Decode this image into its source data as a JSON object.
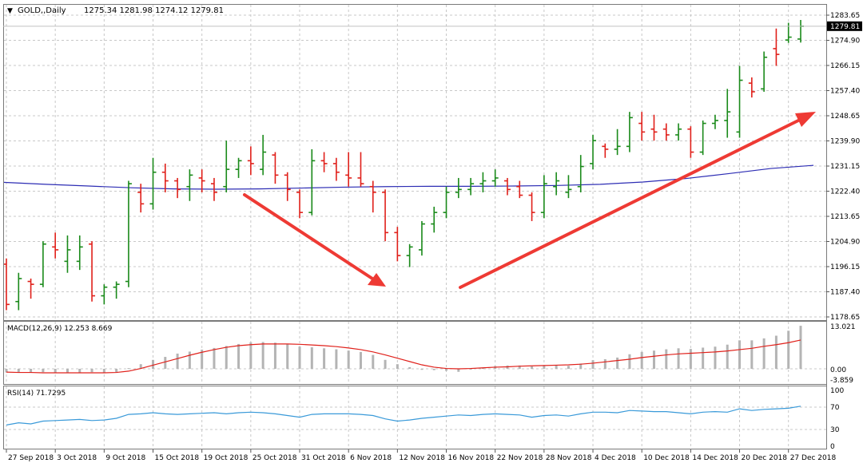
{
  "window": {
    "title_arrow": "▼",
    "symbol": "GOLD,,Daily",
    "ohlc": "1275.34 1281.98 1274.12 1279.81"
  },
  "price_panel": {
    "y_ticks": [
      "1283.65",
      "1274.90",
      "1266.15",
      "1257.40",
      "1248.65",
      "1239.90",
      "1231.15",
      "1222.40",
      "1213.65",
      "1204.90",
      "1196.15",
      "1187.40",
      "1178.65"
    ],
    "current_price_label": "1279.81",
    "current_price": 1279.81
  },
  "macd_panel": {
    "label": "MACD(12,26,9) 12.253 8.669",
    "y_ticks": [
      "13.021",
      "0.00",
      "-3.859"
    ]
  },
  "rsi_panel": {
    "label": "RSI(14) 71.7295",
    "y_ticks": [
      "100",
      "70",
      "30",
      "0"
    ]
  },
  "x_axis": {
    "labels": [
      "27 Sep 2018",
      "3 Oct 2018",
      "9 Oct 2018",
      "15 Oct 2018",
      "19 Oct 2018",
      "25 Oct 2018",
      "31 Oct 2018",
      "6 Nov 2018",
      "12 Nov 2018",
      "16 Nov 2018",
      "22 Nov 2018",
      "28 Nov 2018",
      "4 Dec 2018",
      "10 Dec 2018",
      "14 Dec 2018",
      "20 Dec 2018",
      "27 Dec 2018"
    ]
  },
  "colors": {
    "up_bar": "#1a8a1a",
    "down_bar": "#e0201a",
    "moving_average": "#2d2db4",
    "macd_signal": "#e0201a",
    "macd_histogram": "#b4b4b4",
    "rsi_line": "#3a9ad9",
    "annotation_arrow": "#ee3a34",
    "grid": "#c8c8c8"
  },
  "chart_data": [
    {
      "type": "ohlc",
      "series": [
        {
          "name": "GOLD,,Daily",
          "values": [
            {
              "d": "2018-09-27",
              "o": 1197,
              "h": 1199,
              "l": 1181,
              "c": 1183
            },
            {
              "d": "2018-09-28",
              "o": 1184,
              "h": 1194,
              "l": 1181,
              "c": 1192
            },
            {
              "d": "2018-10-01",
              "o": 1191,
              "h": 1192,
              "l": 1185,
              "c": 1190
            },
            {
              "d": "2018-10-02",
              "o": 1190,
              "h": 1205,
              "l": 1189,
              "c": 1204
            },
            {
              "d": "2018-10-03",
              "o": 1203,
              "h": 1208,
              "l": 1199,
              "c": 1202
            },
            {
              "d": "2018-10-04",
              "o": 1198,
              "h": 1207,
              "l": 1194,
              "c": 1202
            },
            {
              "d": "2018-10-05",
              "o": 1198,
              "h": 1207,
              "l": 1195,
              "c": 1203
            },
            {
              "d": "2018-10-08",
              "o": 1204,
              "h": 1205,
              "l": 1184,
              "c": 1186
            },
            {
              "d": "2018-10-09",
              "o": 1186,
              "h": 1190,
              "l": 1183,
              "c": 1189
            },
            {
              "d": "2018-10-10",
              "o": 1189,
              "h": 1191,
              "l": 1185,
              "c": 1190
            },
            {
              "d": "2018-10-11",
              "o": 1191,
              "h": 1226,
              "l": 1189,
              "c": 1225
            },
            {
              "d": "2018-10-12",
              "o": 1222,
              "h": 1225,
              "l": 1215,
              "c": 1218
            },
            {
              "d": "2018-10-15",
              "o": 1218,
              "h": 1234,
              "l": 1216,
              "c": 1229
            },
            {
              "d": "2018-10-16",
              "o": 1229,
              "h": 1232,
              "l": 1222,
              "c": 1226
            },
            {
              "d": "2018-10-17",
              "o": 1226,
              "h": 1227,
              "l": 1220,
              "c": 1223
            },
            {
              "d": "2018-10-18",
              "o": 1224,
              "h": 1230,
              "l": 1219,
              "c": 1228
            },
            {
              "d": "2018-10-19",
              "o": 1227,
              "h": 1230,
              "l": 1222,
              "c": 1226
            },
            {
              "d": "2018-10-22",
              "o": 1225,
              "h": 1227,
              "l": 1219,
              "c": 1222
            },
            {
              "d": "2018-10-23",
              "o": 1224,
              "h": 1240,
              "l": 1222,
              "c": 1230
            },
            {
              "d": "2018-10-24",
              "o": 1230,
              "h": 1234,
              "l": 1227,
              "c": 1233
            },
            {
              "d": "2018-10-25",
              "o": 1233,
              "h": 1238,
              "l": 1228,
              "c": 1232
            },
            {
              "d": "2018-10-26",
              "o": 1230,
              "h": 1242,
              "l": 1228,
              "c": 1236
            },
            {
              "d": "2018-10-29",
              "o": 1235,
              "h": 1236,
              "l": 1225,
              "c": 1228
            },
            {
              "d": "2018-10-30",
              "o": 1228,
              "h": 1229,
              "l": 1219,
              "c": 1223
            },
            {
              "d": "2018-10-31",
              "o": 1222,
              "h": 1223,
              "l": 1213,
              "c": 1215
            },
            {
              "d": "2018-11-01",
              "o": 1215,
              "h": 1237,
              "l": 1214,
              "c": 1233
            },
            {
              "d": "2018-11-02",
              "o": 1233,
              "h": 1236,
              "l": 1229,
              "c": 1232
            },
            {
              "d": "2018-11-05",
              "o": 1232,
              "h": 1234,
              "l": 1226,
              "c": 1229
            },
            {
              "d": "2018-11-06",
              "o": 1228,
              "h": 1236,
              "l": 1224,
              "c": 1227
            },
            {
              "d": "2018-11-07",
              "o": 1227,
              "h": 1236,
              "l": 1224,
              "c": 1225
            },
            {
              "d": "2018-11-08",
              "o": 1224,
              "h": 1226,
              "l": 1215,
              "c": 1222
            },
            {
              "d": "2018-11-09",
              "o": 1222,
              "h": 1223,
              "l": 1205,
              "c": 1208
            },
            {
              "d": "2018-11-12",
              "o": 1208,
              "h": 1210,
              "l": 1198,
              "c": 1200
            },
            {
              "d": "2018-11-13",
              "o": 1200,
              "h": 1204,
              "l": 1196,
              "c": 1203
            },
            {
              "d": "2018-11-14",
              "o": 1202,
              "h": 1212,
              "l": 1200,
              "c": 1211
            },
            {
              "d": "2018-11-15",
              "o": 1211,
              "h": 1217,
              "l": 1208,
              "c": 1215
            },
            {
              "d": "2018-11-16",
              "o": 1215,
              "h": 1224,
              "l": 1213,
              "c": 1222
            },
            {
              "d": "2018-11-19",
              "o": 1222,
              "h": 1227,
              "l": 1220,
              "c": 1223
            },
            {
              "d": "2018-11-20",
              "o": 1223,
              "h": 1227,
              "l": 1221,
              "c": 1225
            },
            {
              "d": "2018-11-21",
              "o": 1225,
              "h": 1229,
              "l": 1222,
              "c": 1226
            },
            {
              "d": "2018-11-22",
              "o": 1226,
              "h": 1230,
              "l": 1224,
              "c": 1227
            },
            {
              "d": "2018-11-23",
              "o": 1226,
              "h": 1227,
              "l": 1221,
              "c": 1223
            },
            {
              "d": "2018-11-26",
              "o": 1224,
              "h": 1226,
              "l": 1220,
              "c": 1221
            },
            {
              "d": "2018-11-27",
              "o": 1221,
              "h": 1222,
              "l": 1212,
              "c": 1215
            },
            {
              "d": "2018-11-28",
              "o": 1215,
              "h": 1228,
              "l": 1213,
              "c": 1225
            },
            {
              "d": "2018-11-29",
              "o": 1224,
              "h": 1229,
              "l": 1221,
              "c": 1226
            },
            {
              "d": "2018-11-30",
              "o": 1222,
              "h": 1228,
              "l": 1220,
              "c": 1223
            },
            {
              "d": "2018-12-03",
              "o": 1224,
              "h": 1235,
              "l": 1222,
              "c": 1231
            },
            {
              "d": "2018-12-04",
              "o": 1232,
              "h": 1242,
              "l": 1230,
              "c": 1240
            },
            {
              "d": "2018-12-05",
              "o": 1238,
              "h": 1239,
              "l": 1234,
              "c": 1237
            },
            {
              "d": "2018-12-06",
              "o": 1237,
              "h": 1244,
              "l": 1235,
              "c": 1238
            },
            {
              "d": "2018-12-07",
              "o": 1238,
              "h": 1250,
              "l": 1236,
              "c": 1248
            },
            {
              "d": "2018-12-10",
              "o": 1246,
              "h": 1250,
              "l": 1240,
              "c": 1243
            },
            {
              "d": "2018-12-11",
              "o": 1244,
              "h": 1249,
              "l": 1240,
              "c": 1243
            },
            {
              "d": "2018-12-12",
              "o": 1244,
              "h": 1246,
              "l": 1240,
              "c": 1242
            },
            {
              "d": "2018-12-13",
              "o": 1242,
              "h": 1246,
              "l": 1240,
              "c": 1244
            },
            {
              "d": "2018-12-14",
              "o": 1244,
              "h": 1245,
              "l": 1234,
              "c": 1236
            },
            {
              "d": "2018-12-17",
              "o": 1236,
              "h": 1247,
              "l": 1235,
              "c": 1246
            },
            {
              "d": "2018-12-18",
              "o": 1246,
              "h": 1249,
              "l": 1244,
              "c": 1247
            },
            {
              "d": "2018-12-19",
              "o": 1247,
              "h": 1258,
              "l": 1241,
              "c": 1250
            },
            {
              "d": "2018-12-20",
              "o": 1243,
              "h": 1266,
              "l": 1241,
              "c": 1261
            },
            {
              "d": "2018-12-21",
              "o": 1260,
              "h": 1262,
              "l": 1255,
              "c": 1257
            },
            {
              "d": "2018-12-24",
              "o": 1258,
              "h": 1271,
              "l": 1257,
              "c": 1269
            },
            {
              "d": "2018-12-26",
              "o": 1272,
              "h": 1279,
              "l": 1266,
              "c": 1270
            },
            {
              "d": "2018-12-27",
              "o": 1275,
              "h": 1281,
              "l": 1274,
              "c": 1276
            },
            {
              "d": "2018-12-28",
              "o": 1275.34,
              "h": 1281.98,
              "l": 1274.12,
              "c": 1279.81
            }
          ]
        }
      ],
      "moving_average": [
        1225.5,
        1224.8,
        1224.2,
        1223.6,
        1223.2,
        1223.1,
        1223.2,
        1223.5,
        1223.8,
        1224.0,
        1224.1,
        1224.1,
        1224.2,
        1224.4,
        1224.8,
        1225.6,
        1226.8,
        1228.5,
        1230.3,
        1231.4
      ],
      "ylim": [
        1178.65,
        1283.65
      ]
    },
    {
      "type": "bar",
      "ylim": [
        -3.859,
        13.021
      ],
      "histogram": [
        -1.1,
        -1.0,
        -1.0,
        -1.0,
        -1.2,
        -1.1,
        -1.3,
        -1.0,
        -1.2,
        -1.0,
        0.2,
        1.4,
        2.7,
        3.6,
        4.6,
        5.2,
        5.8,
        6.3,
        6.9,
        7.5,
        8.0,
        8.1,
        7.9,
        7.4,
        6.7,
        6.5,
        6.2,
        5.9,
        5.5,
        5.1,
        4.2,
        2.7,
        1.4,
        0.5,
        -0.3,
        -0.4,
        -0.6,
        -0.9,
        -0.2,
        0.3,
        0.8,
        1.0,
        1.0,
        0.7,
        0.9,
        1.0,
        0.9,
        1.6,
        2.6,
        2.9,
        3.4,
        4.4,
        5.1,
        5.5,
        5.9,
        6.2,
        6.0,
        6.4,
        6.7,
        7.3,
        8.6,
        8.6,
        9.2,
        10.0,
        11.5,
        13.0
      ],
      "signal": [
        -1.0,
        -1.1,
        -1.1,
        -1.2,
        -1.2,
        -1.2,
        -1.2,
        -1.2,
        -1.2,
        -1.1,
        -0.7,
        0.1,
        1.1,
        2.1,
        3.1,
        4.1,
        5.0,
        5.8,
        6.5,
        7.0,
        7.3,
        7.5,
        7.5,
        7.5,
        7.4,
        7.2,
        7.0,
        6.7,
        6.3,
        5.8,
        5.1,
        4.2,
        3.2,
        2.2,
        1.2,
        0.5,
        0.1,
        0.0,
        0.1,
        0.3,
        0.5,
        0.6,
        0.8,
        0.9,
        1.0,
        1.1,
        1.2,
        1.4,
        1.7,
        2.1,
        2.5,
        2.9,
        3.4,
        3.8,
        4.2,
        4.5,
        4.7,
        4.9,
        5.1,
        5.4,
        5.8,
        6.2,
        6.8,
        7.3,
        7.9,
        8.7
      ]
    },
    {
      "type": "line",
      "ylim": [
        0,
        100
      ],
      "levels": [
        30,
        70
      ],
      "values": [
        38,
        42,
        40,
        45,
        46,
        47,
        48,
        46,
        47,
        50,
        57,
        58,
        60,
        58,
        57,
        58,
        59,
        60,
        58,
        60,
        61,
        60,
        58,
        55,
        52,
        57,
        58,
        58,
        58,
        57,
        55,
        49,
        45,
        47,
        50,
        52,
        54,
        56,
        55,
        57,
        58,
        57,
        56,
        52,
        55,
        56,
        54,
        58,
        61,
        61,
        60,
        64,
        63,
        62,
        62,
        60,
        58,
        61,
        62,
        61,
        67,
        64,
        66,
        67,
        68,
        71.73
      ]
    }
  ]
}
